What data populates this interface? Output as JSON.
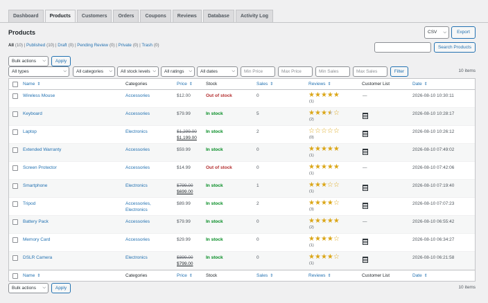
{
  "tabs": [
    "Dashboard",
    "Products",
    "Customers",
    "Orders",
    "Coupons",
    "Reviews",
    "Database",
    "Activity Log"
  ],
  "active_tab": 1,
  "page_title": "Products",
  "subsub": [
    {
      "label": "All",
      "count": "(10)",
      "current": true
    },
    {
      "label": "Published",
      "count": "(10)"
    },
    {
      "label": "Draft",
      "count": "(0)"
    },
    {
      "label": "Pending Review",
      "count": "(0)"
    },
    {
      "label": "Private",
      "count": "(0)"
    },
    {
      "label": "Trash",
      "count": "(0)"
    }
  ],
  "export": {
    "format": "CSV",
    "button": "Export"
  },
  "search": {
    "placeholder": "",
    "button": "Search Products"
  },
  "bulk": {
    "label": "Bulk actions",
    "apply": "Apply"
  },
  "filters": {
    "types": "All types",
    "categories": "All categories",
    "stock": "All stock levels",
    "ratings": "All ratings",
    "dates": "All dates",
    "min_price": "Min Price",
    "max_price": "Max Price",
    "min_sales": "Min Sales",
    "max_sales": "Max Sales",
    "filter_button": "Filter"
  },
  "items_count": "10 items",
  "columns": {
    "name": "Name",
    "categories": "Categories",
    "price": "Price",
    "stock": "Stock",
    "sales": "Sales",
    "reviews": "Reviews",
    "customer_list": "Customer List",
    "date": "Date",
    "sort_glyph": "⇕"
  },
  "products": [
    {
      "name": "Wireless Mouse",
      "category": "Accessories",
      "category2": "",
      "price_old": "",
      "price": "$12.00",
      "stock": "Out of stock",
      "in_stock": false,
      "sales": "0",
      "rating": 5,
      "reviews": "(1)",
      "has_list": false,
      "date": "2026-08-10 10:30:11"
    },
    {
      "name": "Keyboard",
      "category": "Accessories",
      "category2": "",
      "price_old": "",
      "price": "$79.99",
      "stock": "In stock",
      "in_stock": true,
      "sales": "5",
      "rating": 3.5,
      "reviews": "(2)",
      "has_list": true,
      "date": "2026-08-10 10:28:17"
    },
    {
      "name": "Laptop",
      "category": "Electronics",
      "category2": "",
      "price_old": "$1,299.00",
      "price": "$1,199.00",
      "stock": "In stock",
      "in_stock": true,
      "sales": "2",
      "rating": 0,
      "reviews": "(0)",
      "has_list": true,
      "date": "2026-08-10 10:26:12"
    },
    {
      "name": "Extended Warranty",
      "category": "Accessories",
      "category2": "",
      "price_old": "",
      "price": "$59.99",
      "stock": "In stock",
      "in_stock": true,
      "sales": "0",
      "rating": 5,
      "reviews": "(1)",
      "has_list": true,
      "date": "2026-08-10 07:49:02"
    },
    {
      "name": "Screen Protector",
      "category": "Accessories",
      "category2": "",
      "price_old": "",
      "price": "$14.99",
      "stock": "Out of stock",
      "in_stock": false,
      "sales": "0",
      "rating": 5,
      "reviews": "(1)",
      "has_list": false,
      "date": "2026-08-10 07:42:06"
    },
    {
      "name": "Smartphone",
      "category": "Electronics",
      "category2": "",
      "price_old": "$799.00",
      "price": "$699.00",
      "stock": "In stock",
      "in_stock": true,
      "sales": "1",
      "rating": 3,
      "reviews": "(1)",
      "has_list": true,
      "date": "2026-08-10 07:19:40"
    },
    {
      "name": "Tripod",
      "category": "Accessories,",
      "category2": "Electronics",
      "price_old": "",
      "price": "$89.99",
      "stock": "In stock",
      "in_stock": true,
      "sales": "2",
      "rating": 4,
      "reviews": "(3)",
      "has_list": true,
      "date": "2026-08-10 07:07:23"
    },
    {
      "name": "Battery Pack",
      "category": "Accessories",
      "category2": "",
      "price_old": "",
      "price": "$79.99",
      "stock": "In stock",
      "in_stock": true,
      "sales": "0",
      "rating": 5,
      "reviews": "(2)",
      "has_list": false,
      "date": "2026-08-10 06:55:42"
    },
    {
      "name": "Memory Card",
      "category": "Accessories",
      "category2": "",
      "price_old": "",
      "price": "$29.99",
      "stock": "In stock",
      "in_stock": true,
      "sales": "0",
      "rating": 4,
      "reviews": "(1)",
      "has_list": true,
      "date": "2026-08-10 06:34:27"
    },
    {
      "name": "DSLR Camera",
      "category": "Electronics",
      "category2": "",
      "price_old": "$899.00",
      "price": "$799.00",
      "stock": "In stock",
      "in_stock": true,
      "sales": "0",
      "rating": 4,
      "reviews": "(1)",
      "has_list": true,
      "date": "2026-08-10 06:21:58"
    }
  ],
  "no_list_glyph": "—",
  "colors": {
    "accent": "#2271b1",
    "out_of_stock": "#b32d2e",
    "in_stock": "#008a20",
    "star": "#dba617"
  }
}
